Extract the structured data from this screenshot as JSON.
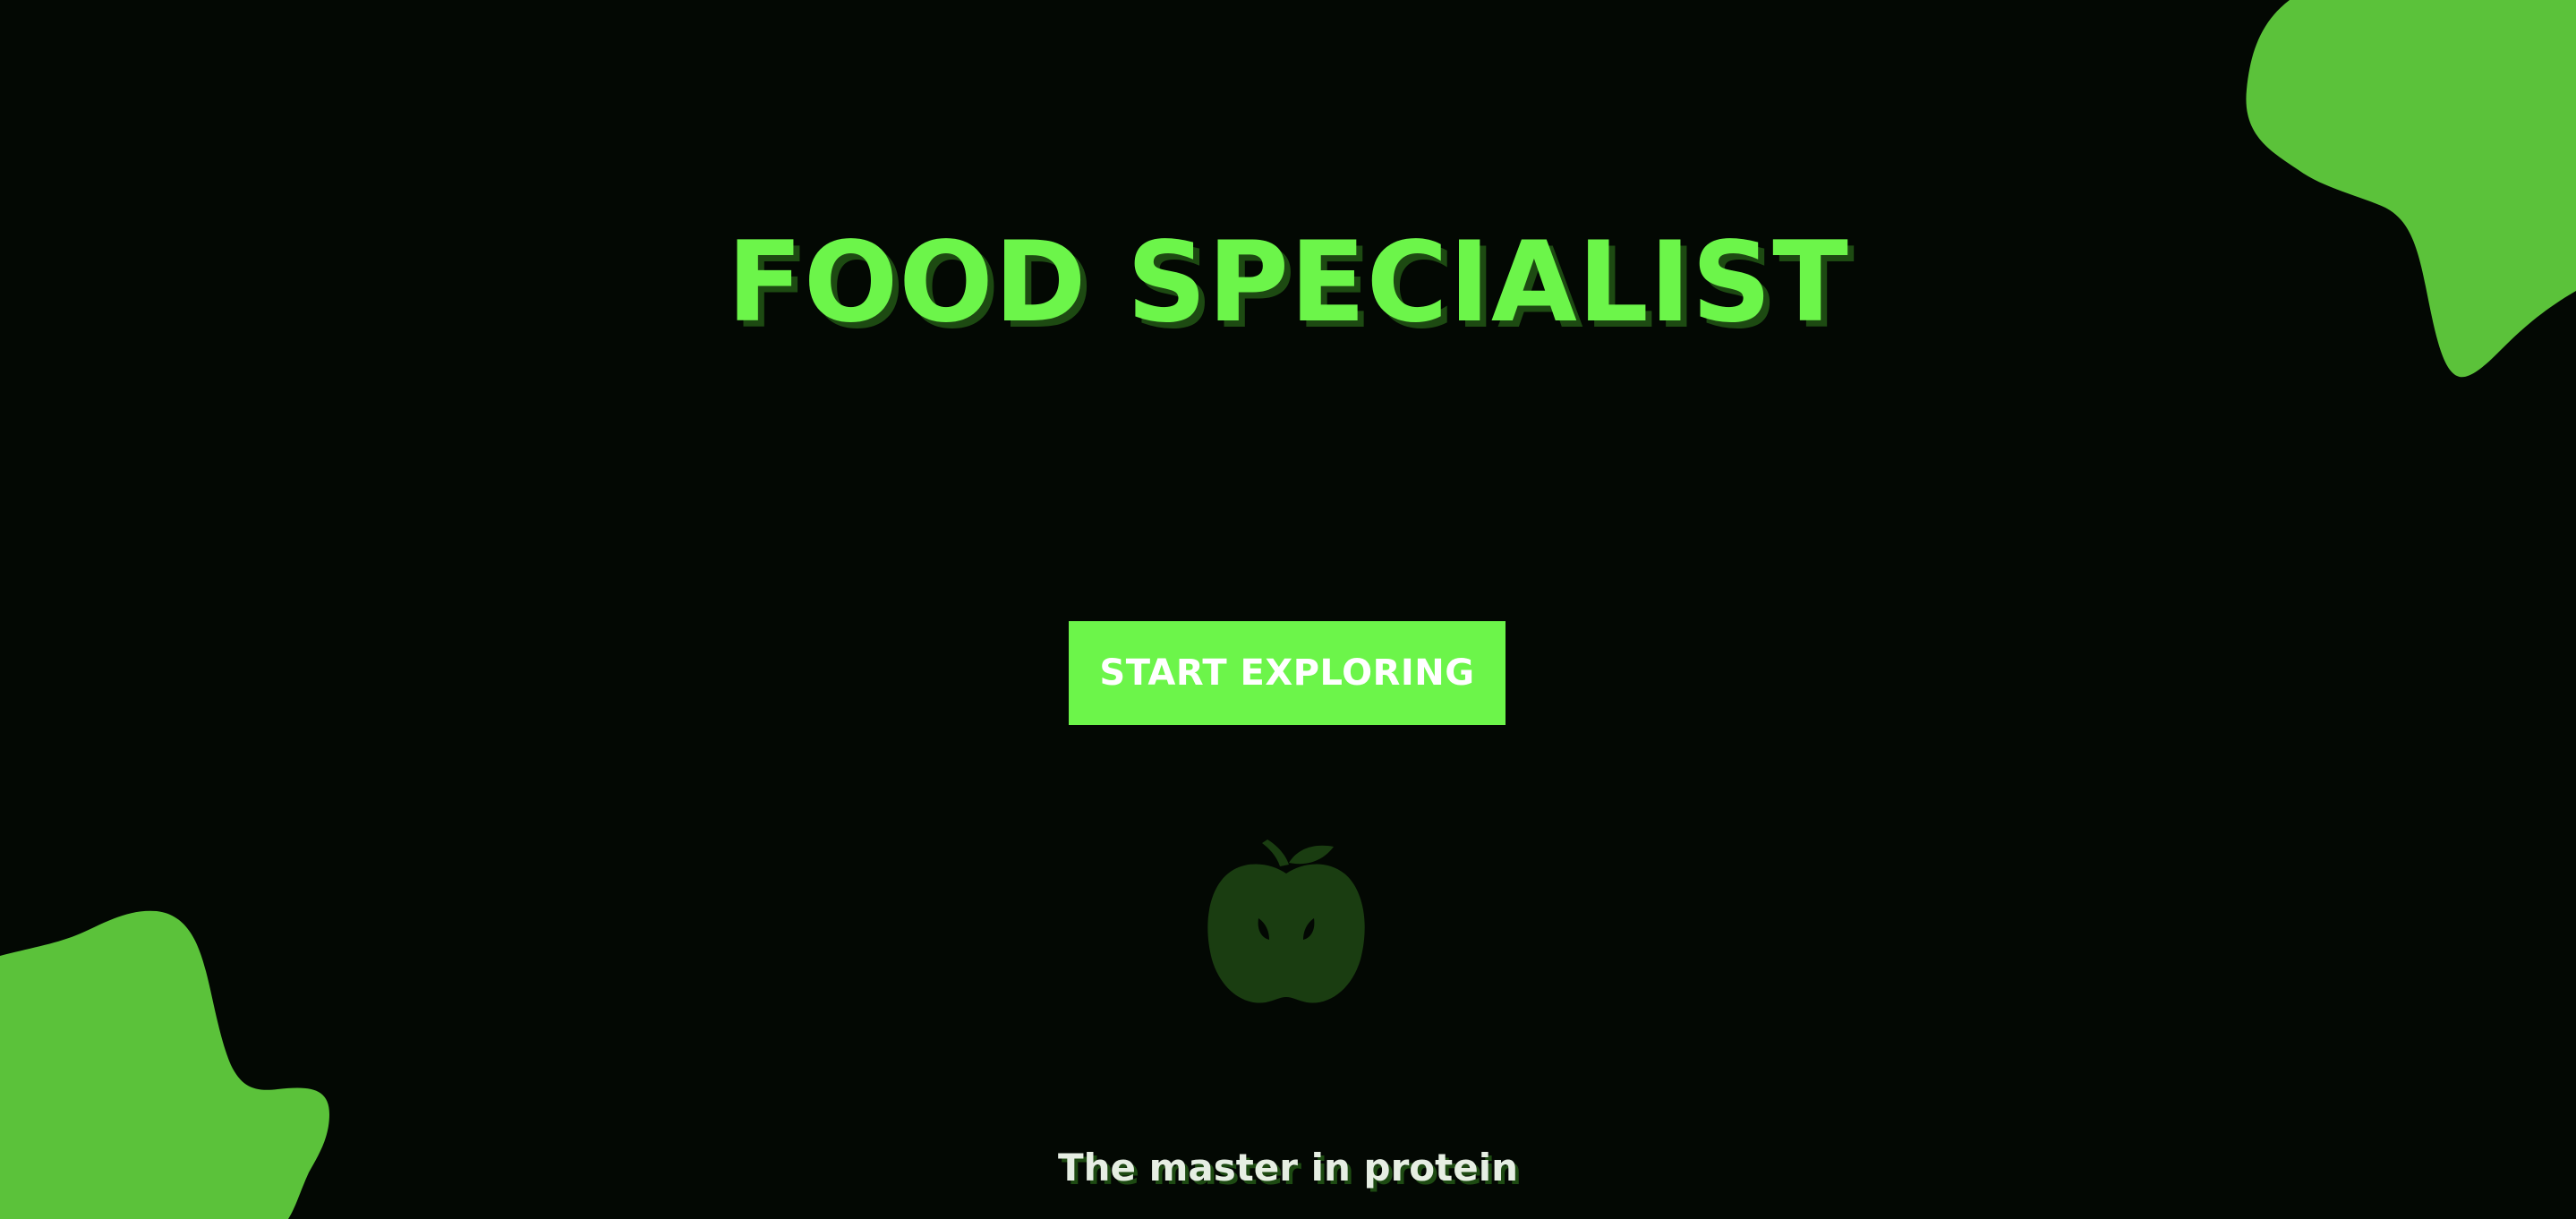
{
  "hero": {
    "title": "FOOD SPECIALIST",
    "cta_label": "START EXPLORING",
    "tagline": "The master in protein",
    "icon": "apple-icon"
  },
  "decor": {
    "shapes": [
      "blob-top-right",
      "blob-bottom-left"
    ]
  },
  "colors": {
    "background": "#030803",
    "title": "#6cf54a",
    "title_shadow": "#1d4a12",
    "cta_background": "#6cf54a",
    "cta_text": "#ffffff",
    "blob": "#5bc23a",
    "apple": "#1a3d11",
    "tagline": "#e6eee3"
  }
}
